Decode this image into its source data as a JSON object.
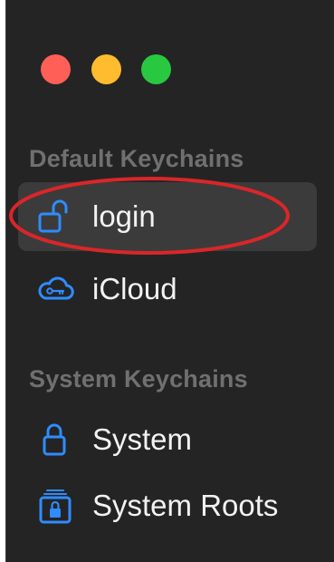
{
  "window_controls": {
    "close_color": "#ff5f57",
    "minimize_color": "#febc2e",
    "zoom_color": "#28c840"
  },
  "sidebar": {
    "sections": [
      {
        "title": "Default Keychains",
        "items": [
          {
            "label": "login",
            "icon": "unlocked-padlock-icon",
            "selected": true
          },
          {
            "label": "iCloud",
            "icon": "icloud-key-icon",
            "selected": false
          }
        ]
      },
      {
        "title": "System Keychains",
        "items": [
          {
            "label": "System",
            "icon": "padlock-icon",
            "selected": false
          },
          {
            "label": "System Roots",
            "icon": "locked-cabinet-icon",
            "selected": false
          }
        ]
      }
    ]
  },
  "annotation": {
    "color": "#d9262a",
    "target": "login"
  },
  "colors": {
    "icon_accent": "#2f8cff",
    "sidebar_background": "#242424",
    "selected_background": "#3b3b3b"
  }
}
